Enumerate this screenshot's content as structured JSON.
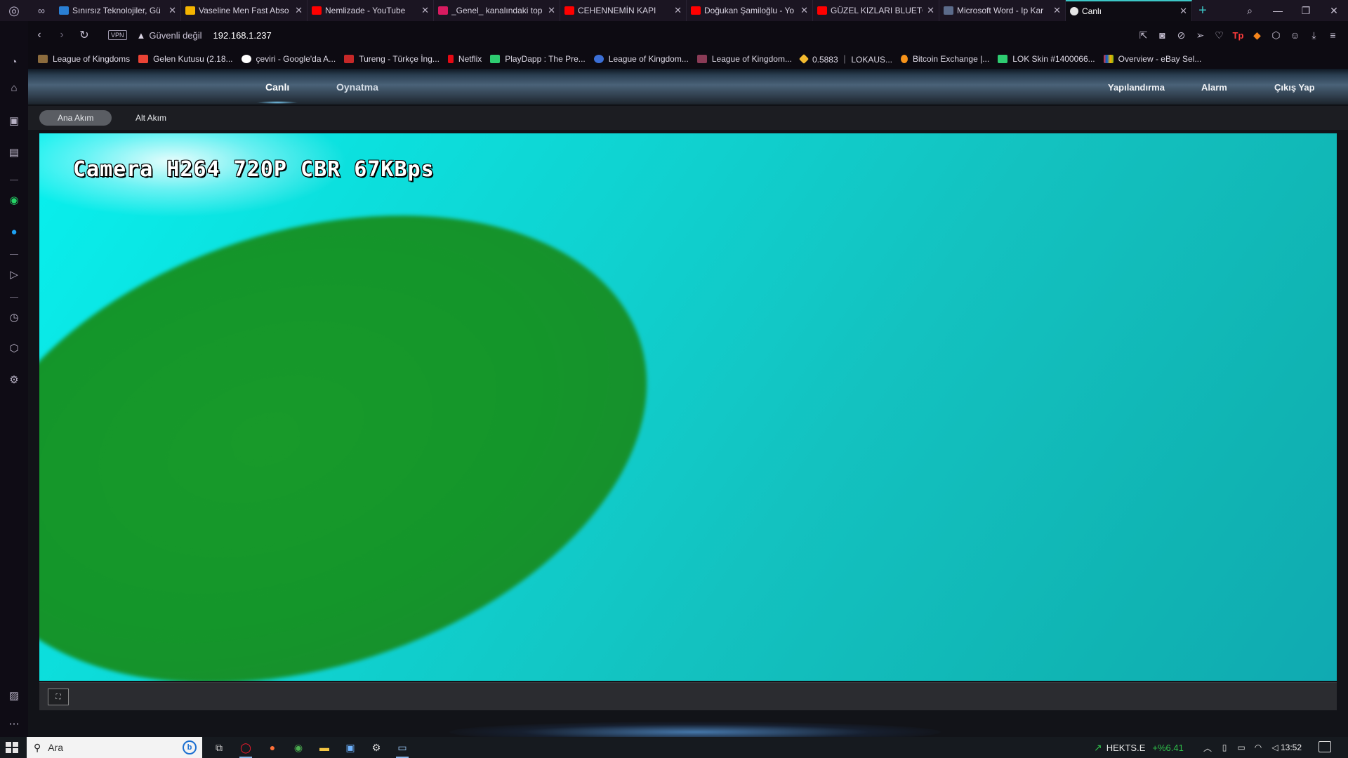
{
  "browser": {
    "tabs": [
      {
        "label": "Sınırsız Teknolojiler, Gü",
        "fav_color": "#2a7fd4"
      },
      {
        "label": "Vaseline Men Fast Abso",
        "fav_color": "#f4b400"
      },
      {
        "label": "Nemlizade - YouTube",
        "fav_color": "#ff0000"
      },
      {
        "label": "_Genel_ kanalındaki top",
        "fav_color": "#d81b60"
      },
      {
        "label": "CEHENNEMİN KAPI",
        "fav_color": "#ff0000"
      },
      {
        "label": "Doğukan Şamiloğlu - Yo",
        "fav_color": "#ff0000"
      },
      {
        "label": "GÜZEL KIZLARI BLUETO",
        "fav_color": "#ff0000"
      },
      {
        "label": "Microsoft Word - Ip Kar",
        "fav_color": "#5b6b8a"
      },
      {
        "label": "Canlı",
        "fav_color": "#e6e6e6",
        "active": true
      }
    ],
    "address": {
      "vpn_label": "VPN",
      "security_text": "Güvenli değil",
      "url": "192.168.1.237"
    },
    "bookmarks": [
      {
        "label": "League of Kingdoms",
        "fav_color": "#8b6b3d"
      },
      {
        "label": "Gelen Kutusu (2.18...",
        "fav_color": "#ea4335"
      },
      {
        "label": "çeviri - Google'da A...",
        "fav_color": "#ffffff"
      },
      {
        "label": "Tureng - Türkçe İng...",
        "fav_color": "#c62828"
      },
      {
        "label": "Netflix",
        "fav_color": "#e50914"
      },
      {
        "label": "PlayDapp : The Pre...",
        "fav_color": "#2ecc71"
      },
      {
        "label": "League of Kingdom...",
        "fav_color": "#3b6fd6"
      },
      {
        "label": "League of Kingdom...",
        "fav_color": "#8a3b56"
      },
      {
        "label": "0.5883 ｜ LOKAUS...",
        "fav_color": "#f3ba2f"
      },
      {
        "label": "Bitcoin Exchange |...",
        "fav_color": "#f7931a"
      },
      {
        "label": "LOK Skin #1400066...",
        "fav_color": "#2ecc71"
      },
      {
        "label": "Overview - eBay Sel...",
        "fav_color": "#e53238"
      }
    ]
  },
  "app": {
    "nav_left": [
      {
        "label": "Canlı",
        "active": true
      },
      {
        "label": "Oynatma",
        "active": false
      }
    ],
    "nav_right": [
      {
        "label": "Yapılandırma"
      },
      {
        "label": "Alarm"
      },
      {
        "label": "Çıkış Yap"
      }
    ],
    "streams": [
      {
        "label": "Ana Akım",
        "active": true
      },
      {
        "label": "Alt Akım",
        "active": false
      }
    ],
    "video_osd": "Camera H264 720P CBR 67KBps",
    "controls": {
      "fullscreen_label": "⛶"
    }
  },
  "taskbar": {
    "search_placeholder": "Ara",
    "stock": {
      "symbol": "HEKTS.E",
      "change": "+%6.41"
    },
    "time": "13:52"
  },
  "colors": {
    "video_cyan": "#0ed8d6",
    "video_green": "#14962a",
    "active_tab_accent": "#3cc7c7"
  }
}
